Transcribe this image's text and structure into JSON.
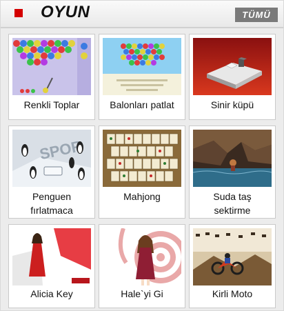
{
  "header": {
    "title": "OYUN",
    "all_button": "TÜMÜ"
  },
  "games": [
    {
      "name": "Renkli Toplar",
      "thumb": "bubble-shooter"
    },
    {
      "name": "Balonları patlat",
      "thumb": "balloons"
    },
    {
      "name": "Sinir küpü",
      "thumb": "cube"
    },
    {
      "name": "Penguen fırlatmaca",
      "line1": "Penguen",
      "line2": "fırlatmaca",
      "thumb": "penguins"
    },
    {
      "name": "Mahjong",
      "thumb": "mahjong"
    },
    {
      "name": "Suda taş sektirme",
      "line1": "Suda taş",
      "line2": "sektirme",
      "thumb": "cave"
    },
    {
      "name": "Alicia Key",
      "thumb": "alicia"
    },
    {
      "name": "Hale`yi Gi",
      "thumb": "anime-girl"
    },
    {
      "name": "Kirli Moto",
      "thumb": "moto"
    }
  ],
  "colors": {
    "accent": "#d40000",
    "button_bg": "#7a7a7a"
  }
}
